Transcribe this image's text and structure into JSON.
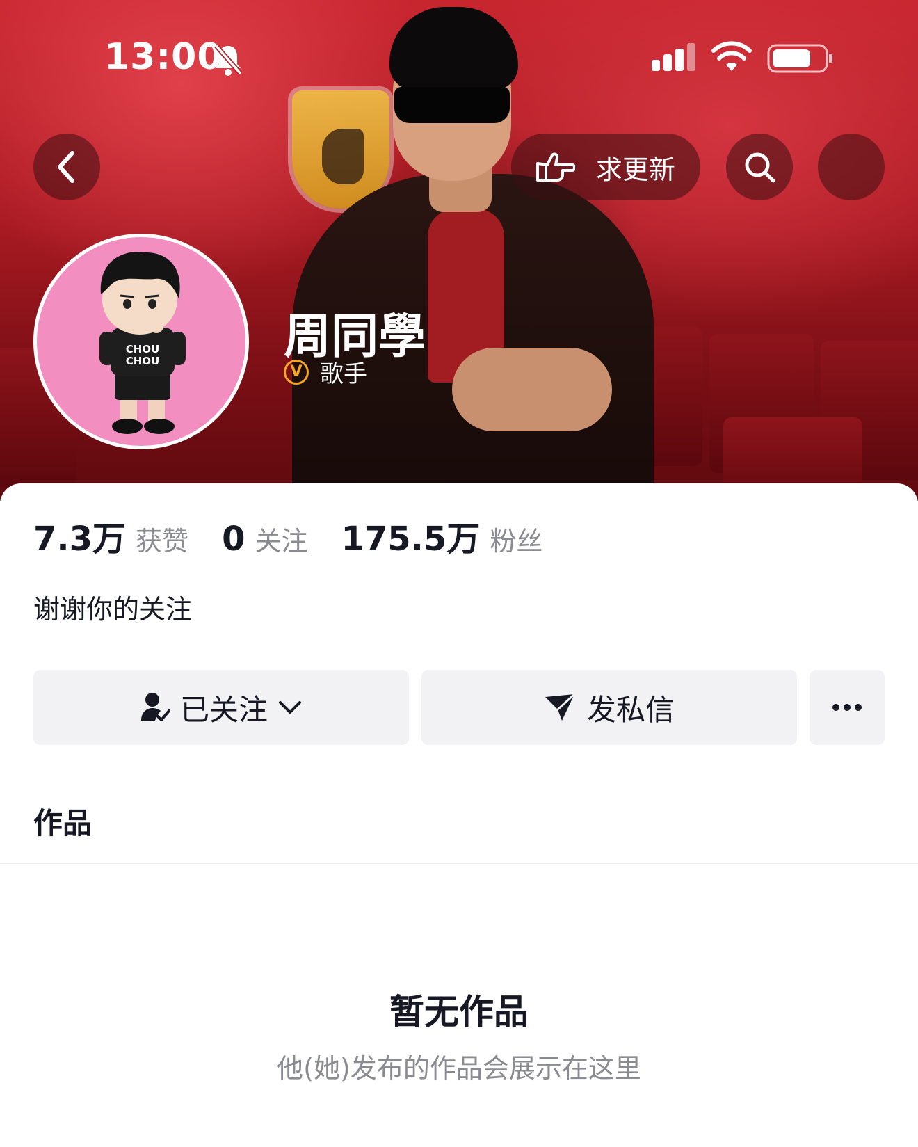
{
  "status_bar": {
    "time": "13:00",
    "icons": [
      "bell-muted-icon",
      "cellular-signal-icon",
      "wifi-icon",
      "battery-icon"
    ]
  },
  "top_nav": {
    "back_icon": "chevron-left-icon",
    "request_update_label": "求更新",
    "request_update_icon": "pointing-hand-icon",
    "search_icon": "search-icon"
  },
  "profile": {
    "name": "周同學",
    "verified_badge": "V",
    "verified_title": "歌手",
    "avatar_shirt_text": "CHOU CHOU"
  },
  "stats": [
    {
      "value": "7.3万",
      "label": "获赞"
    },
    {
      "value": "0",
      "label": "关注"
    },
    {
      "value": "175.5万",
      "label": "粉丝"
    }
  ],
  "bio": "谢谢你的关注",
  "actions": {
    "following_label": "已关注",
    "message_label": "发私信",
    "more_icon": "more-dots-icon"
  },
  "tabs": {
    "works_label": "作品"
  },
  "empty_state": {
    "title": "暂无作品",
    "subtitle": "他(她)发布的作品会展示在这里"
  },
  "colors": {
    "header_red": "#c8262f",
    "text_primary": "#161823",
    "text_secondary": "#8a8b91",
    "button_bg": "#f2f2f4",
    "verify_gold": "#f5a623",
    "avatar_pink": "#f28fc0"
  }
}
